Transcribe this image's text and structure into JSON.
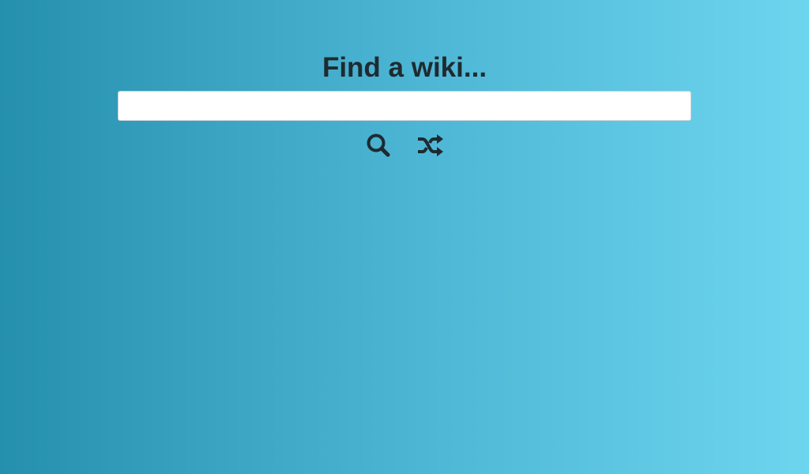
{
  "header": {
    "title": "Find a wiki..."
  },
  "search": {
    "value": "",
    "placeholder": ""
  },
  "icons": {
    "search": "search-icon",
    "random": "shuffle-icon"
  },
  "colors": {
    "gradient_start": "#2590ae",
    "gradient_end": "#6dd5ee",
    "text": "#1f2a30",
    "input_background": "#ffffff"
  }
}
